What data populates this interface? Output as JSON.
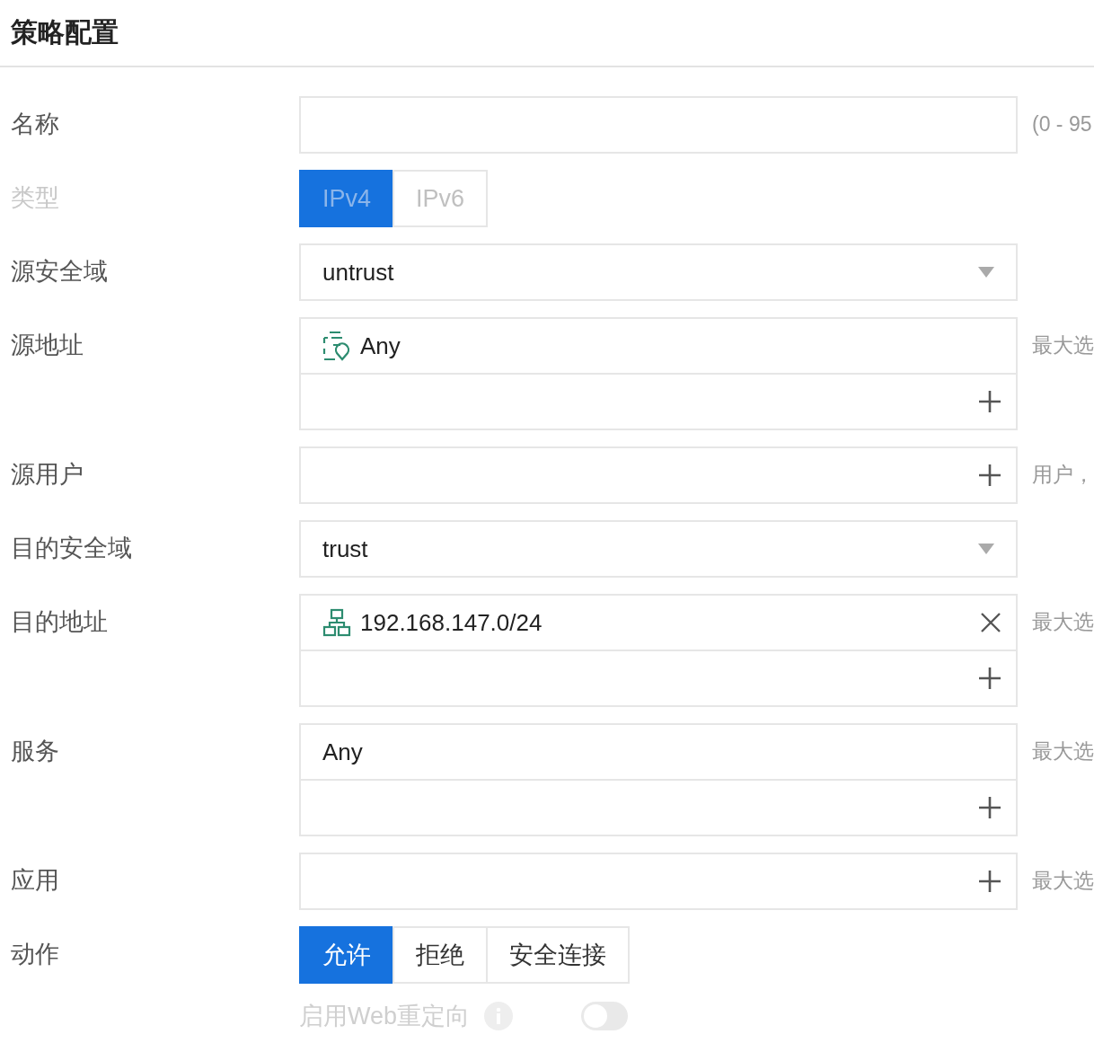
{
  "title": "策略配置",
  "fields": [
    {
      "label": "名称",
      "kind": "text",
      "hint": "(0 - 95"
    },
    {
      "label": "类型",
      "kind": "segmented",
      "disabled": true,
      "options": [
        {
          "label": "IPv4",
          "selected": true
        },
        {
          "label": "IPv6",
          "selected": false
        }
      ]
    },
    {
      "label": "源安全域",
      "kind": "select",
      "value": "untrust"
    },
    {
      "label": "源地址",
      "kind": "list",
      "hint": "最大选",
      "items": [
        {
          "text": "Any",
          "kind": "address",
          "removable": false
        }
      ]
    },
    {
      "label": "源用户",
      "kind": "adder",
      "hint": "用户，"
    },
    {
      "label": "目的安全域",
      "kind": "select",
      "value": "trust"
    },
    {
      "label": "目的地址",
      "kind": "list",
      "hint": "最大选",
      "items": [
        {
          "text": "192.168.147.0/24",
          "kind": "network",
          "removable": true
        }
      ]
    },
    {
      "label": "服务",
      "kind": "list",
      "hint": "最大选",
      "items": [
        {
          "text": "Any",
          "removable": false
        }
      ]
    },
    {
      "label": "应用",
      "kind": "adder",
      "hint": "最大选"
    },
    {
      "label": "动作",
      "kind": "segmented",
      "disabled": false,
      "options": [
        {
          "label": "允许",
          "selected": true
        },
        {
          "label": "拒绝",
          "selected": false
        },
        {
          "label": "安全连接",
          "selected": false
        }
      ]
    }
  ],
  "web_redirect": {
    "label": "启用Web重定向",
    "disabled": true,
    "on": false
  }
}
